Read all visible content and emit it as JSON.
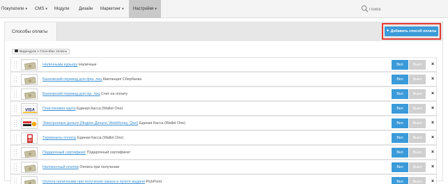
{
  "nav": {
    "items": [
      "Покупатели",
      "CMS",
      "Модули",
      "Дизайн",
      "Маркетинг",
      "Настройки"
    ],
    "search_placeholder": "Поиск"
  },
  "panel": {
    "tab_label": "Способы оплаты",
    "add_button": "Добавить способ оплаты",
    "video_link": "Видеоурок о Способах оплаты"
  },
  "rows": [
    {
      "link": "Наличными курьеру",
      "text": "Наличные",
      "icon": "banknotes-icon"
    },
    {
      "link": "Банковский перевод для физ. лиц",
      "text": "Квитанция Сбербанка",
      "icon": "banknotes-icon"
    },
    {
      "link": "Банковский перевод для юр. лиц",
      "text": "Счет на оплату",
      "icon": "banknotes-icon"
    },
    {
      "link": "Пластиковая карта",
      "text": "Единая Касса (Wallet One)",
      "icon": "visa-card-icon"
    },
    {
      "link": "Электронные деньги (Яндекс.Деньги, WebMoney, Qiwi)",
      "text": "Единая Касса (Wallet One)",
      "icon": "yandex-money-icon"
    },
    {
      "link": "Терминалы оплаты",
      "text": "Единая Касса (Wallet One)",
      "icon": "payment-terminal-icon"
    },
    {
      "link": "Подарочный сертификат",
      "text": "Подарочный сертификат",
      "icon": "banknotes-icon"
    },
    {
      "link": "Наложенный платеж",
      "text": "Оплата при получении",
      "icon": "banknotes-icon"
    },
    {
      "link": "Оплата наличными при получении заказа в пункте выдачи",
      "text": "PickPoint",
      "icon": "banknotes-icon"
    }
  ],
  "row_buttons": {
    "on": "Вкл",
    "off": "Выкл",
    "delete": "×"
  },
  "colors": {
    "accent": "#3b9ad9",
    "highlight": "#e53935",
    "link": "#3d8fd1"
  }
}
